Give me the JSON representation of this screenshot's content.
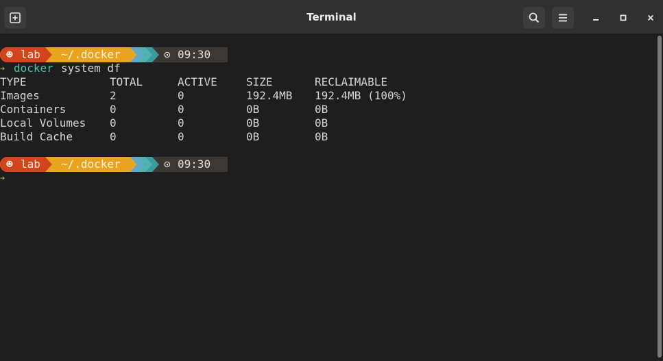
{
  "window": {
    "title": "Terminal"
  },
  "colors": {
    "background": "#1e1e1e",
    "titlebar": "#303030",
    "user_segment": "#d2441b",
    "path_segment": "#e8a321",
    "git_segment": "#3a9e9e",
    "time_segment": "#3d3833",
    "prompt_arrow": "#9bc53d",
    "command": "#4fc1a6"
  },
  "icons": {
    "new_tab": "new-tab-icon",
    "search": "search-icon",
    "menu": "hamburger-menu-icon",
    "minimize": "minimize-icon",
    "maximize": "maximize-icon",
    "close": "close-icon"
  },
  "prompt": {
    "user_icon": "☻",
    "user": "lab",
    "path": "~/.docker",
    "clock_icon": "⊙",
    "time": "09:30",
    "arrow": "➔"
  },
  "command": {
    "name": "docker",
    "args": "system df"
  },
  "table": {
    "headers": [
      "TYPE",
      "TOTAL",
      "ACTIVE",
      "SIZE",
      "RECLAIMABLE"
    ],
    "rows": [
      [
        "Images",
        "2",
        "0",
        "192.4MB",
        "192.4MB (100%)"
      ],
      [
        "Containers",
        "0",
        "0",
        "0B",
        "0B"
      ],
      [
        "Local Volumes",
        "0",
        "0",
        "0B",
        "0B"
      ],
      [
        "Build Cache",
        "0",
        "0",
        "0B",
        "0B"
      ]
    ]
  }
}
